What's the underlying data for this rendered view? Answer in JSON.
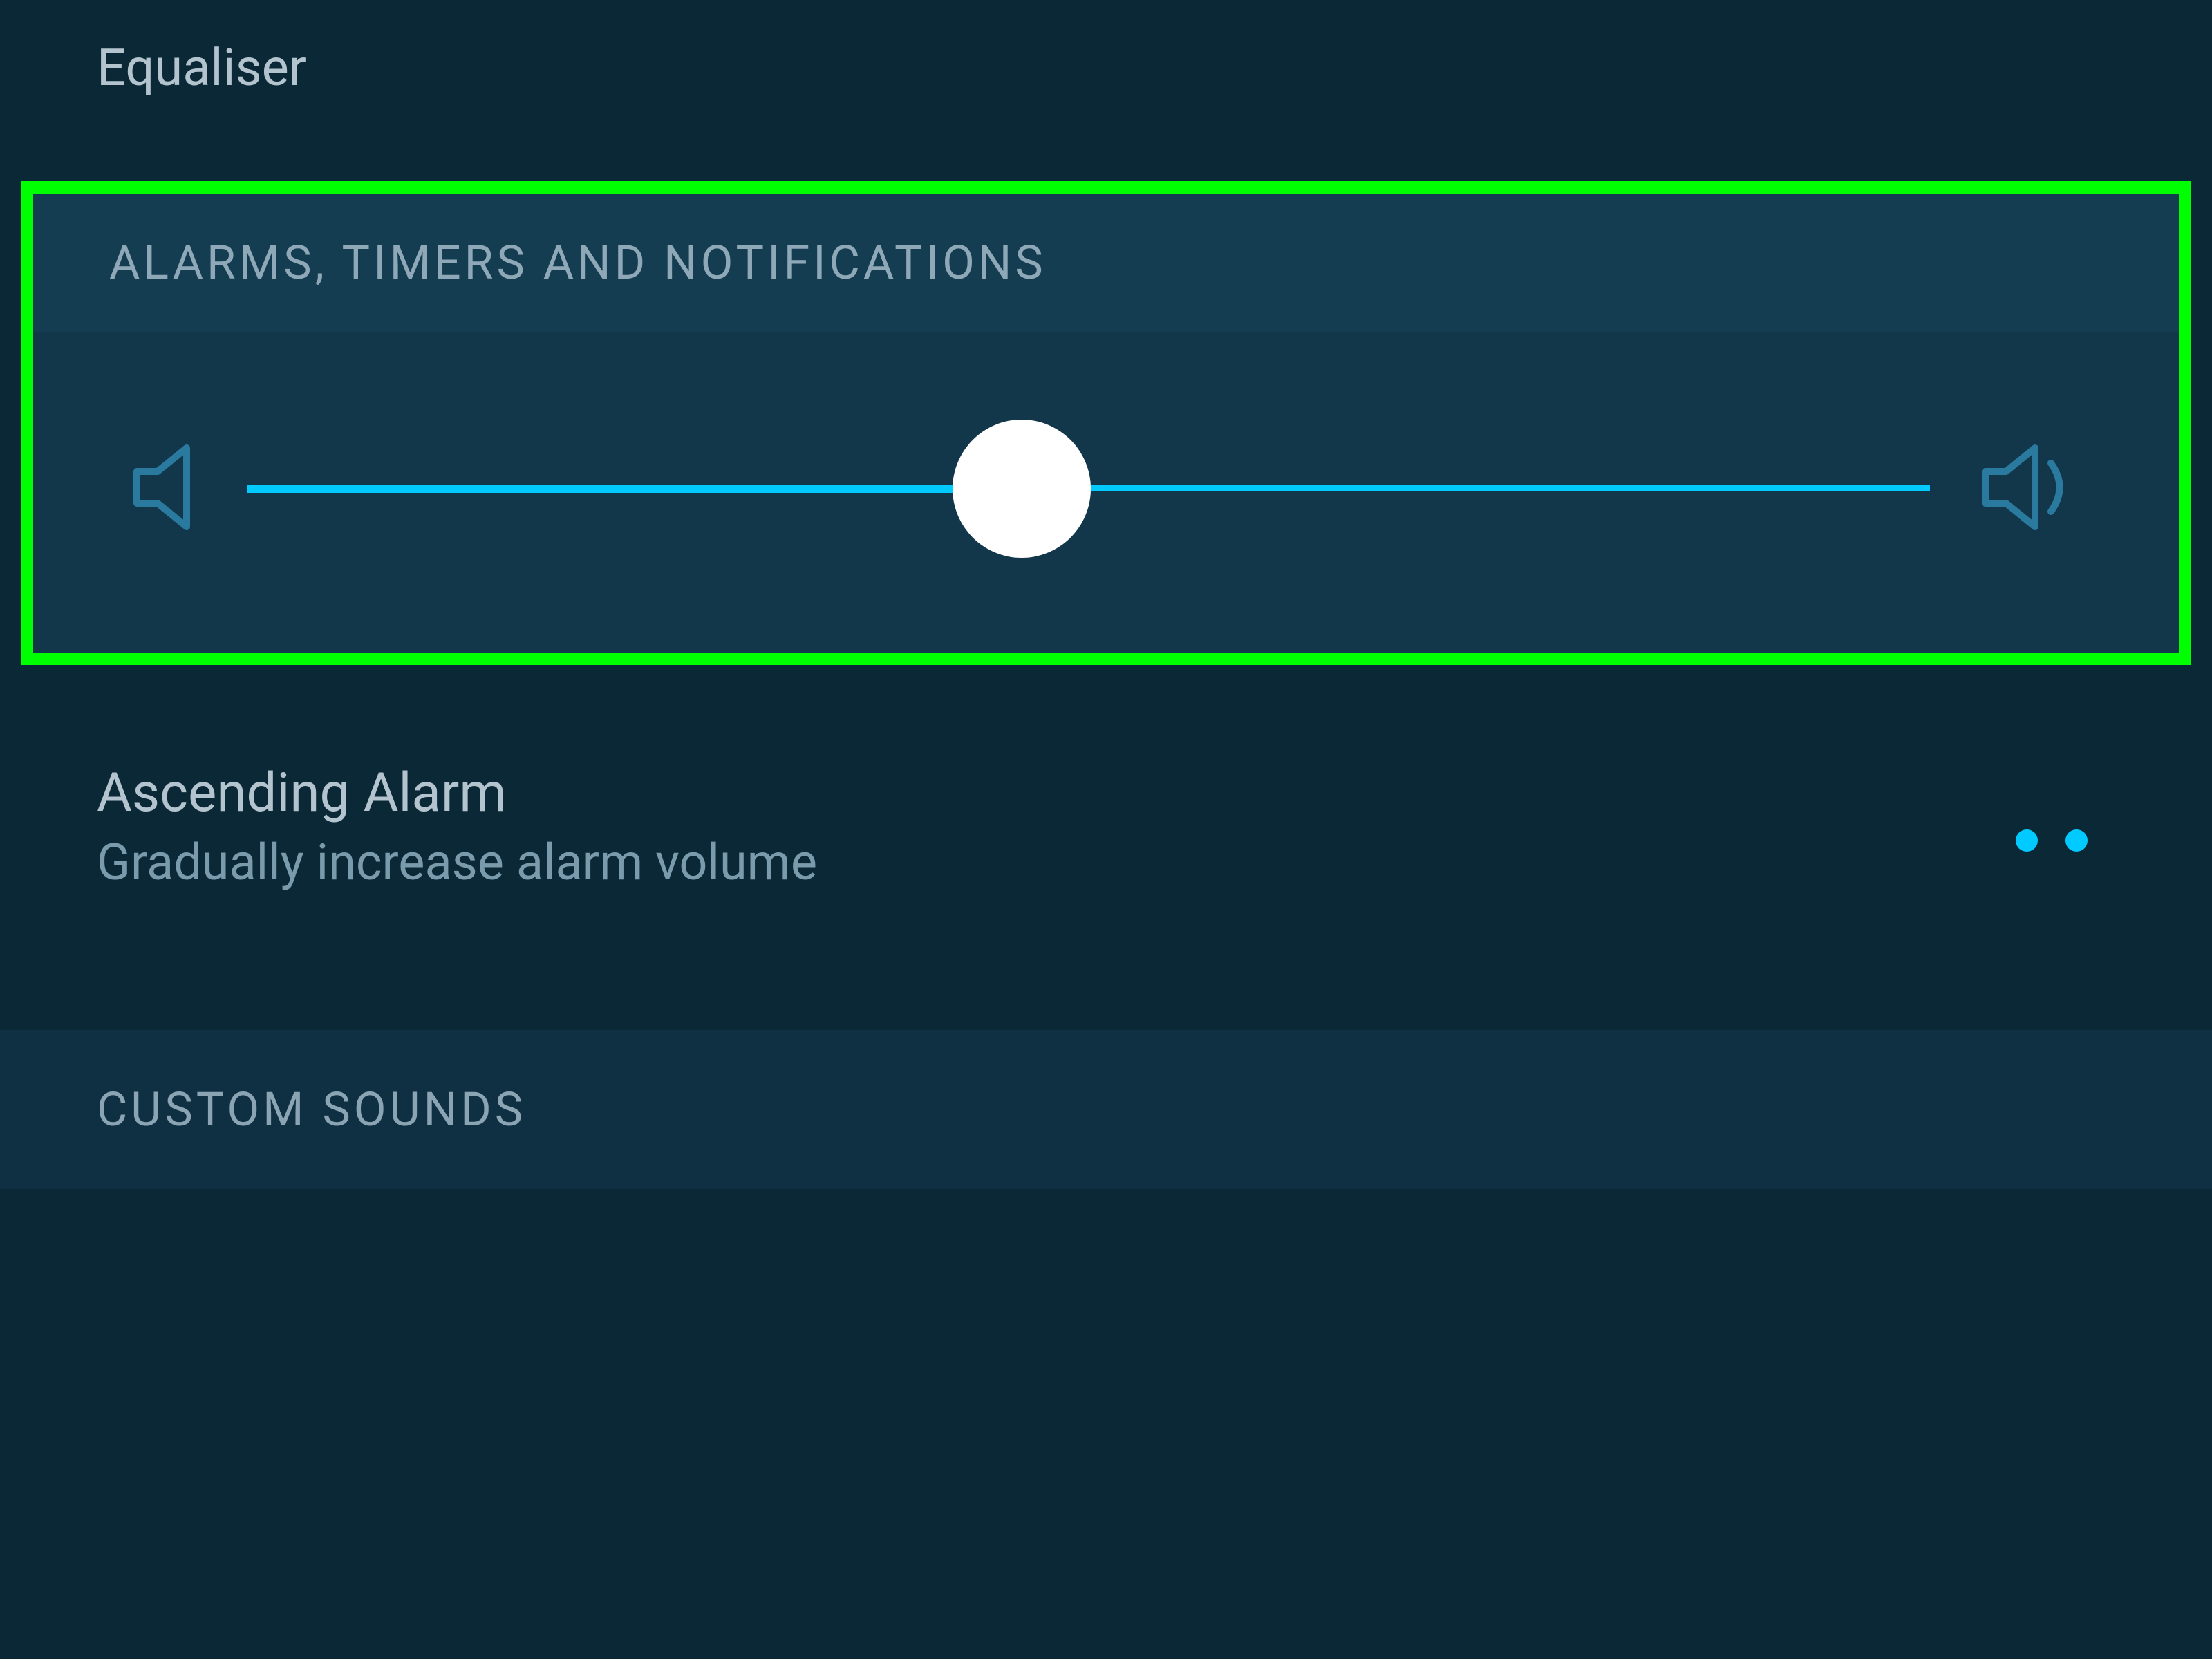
{
  "equaliser": {
    "label": "Equaliser"
  },
  "alarms_section": {
    "header": "ALARMS, TIMERS AND NOTIFICATIONS",
    "volume_percent": 46
  },
  "ascending_alarm": {
    "title": "Ascending Alarm",
    "subtitle": "Gradually increase alarm volume"
  },
  "custom_sounds": {
    "header": "CUSTOM SOUNDS"
  },
  "colors": {
    "background": "#0a2836",
    "section_bg": "#12374a",
    "header_bg": "#153d52",
    "accent": "#00caff",
    "highlight": "#00ff00",
    "text_primary": "#b4c4cf",
    "text_secondary": "#7a9bab"
  }
}
